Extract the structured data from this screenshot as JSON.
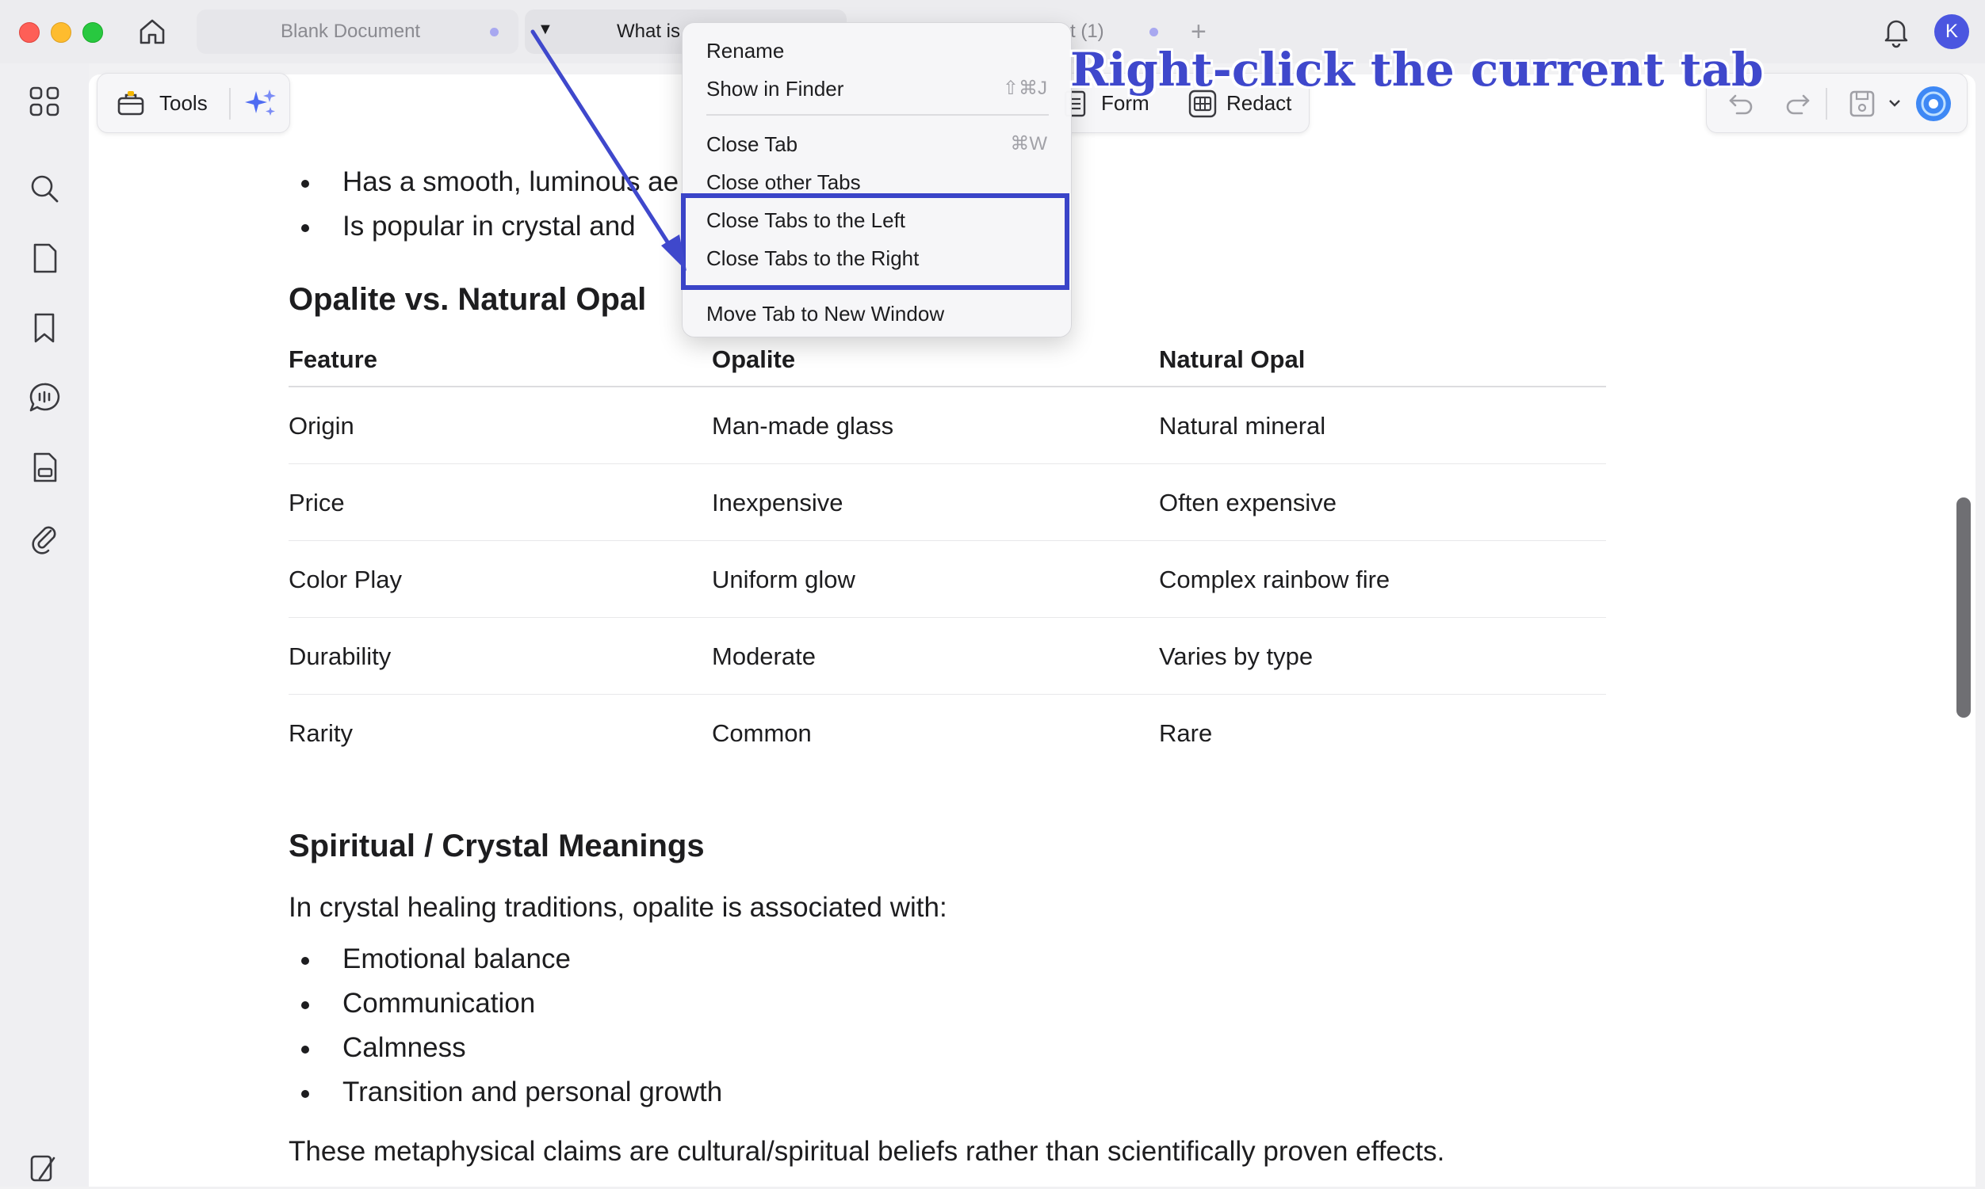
{
  "tabs": [
    {
      "label": "Blank Document"
    },
    {
      "label": "What is"
    },
    {
      "label": "t (1)"
    }
  ],
  "user": {
    "initial": "K"
  },
  "toolbar": {
    "tools_label": "Tools",
    "form_label": "Form",
    "redact_label": "Redact"
  },
  "context_menu": {
    "items": [
      {
        "label": "Rename",
        "shortcut": ""
      },
      {
        "label": "Show in Finder",
        "shortcut": "⇧⌘J"
      },
      {
        "label": "Close Tab",
        "shortcut": "⌘W"
      },
      {
        "label": "Close other Tabs",
        "shortcut": ""
      },
      {
        "label": "Close Tabs to the Left",
        "shortcut": ""
      },
      {
        "label": "Close Tabs to the Right",
        "shortcut": ""
      },
      {
        "label": "Move Tab to New Window",
        "shortcut": ""
      }
    ]
  },
  "annotation": {
    "text": "Right-click the current tab"
  },
  "document": {
    "top_bullets": [
      "Has a smooth, luminous ae",
      "Is popular in crystal and "
    ],
    "section1_title": "Opalite vs. Natural Opal",
    "table": {
      "headers": [
        "Feature",
        "Opalite",
        "Natural Opal"
      ],
      "rows": [
        [
          "Origin",
          "Man-made glass",
          "Natural mineral"
        ],
        [
          "Price",
          "Inexpensive",
          "Often expensive"
        ],
        [
          "Color Play",
          "Uniform glow",
          "Complex rainbow fire"
        ],
        [
          "Durability",
          "Moderate",
          "Varies by type"
        ],
        [
          "Rarity",
          "Common",
          "Rare"
        ]
      ]
    },
    "section2_title": "Spiritual / Crystal Meanings",
    "section2_intro": "In crystal healing traditions, opalite is associated with:",
    "meaning_bullets": [
      "Emotional balance",
      "Communication",
      "Calmness",
      "Transition and personal growth"
    ],
    "closing": "These metaphysical claims are cultural/spiritual beliefs rather than scientifically proven effects."
  },
  "colors": {
    "accent": "#3f48cc",
    "highlight_border": "#3a44c8",
    "avatar": "#4b56e0"
  }
}
